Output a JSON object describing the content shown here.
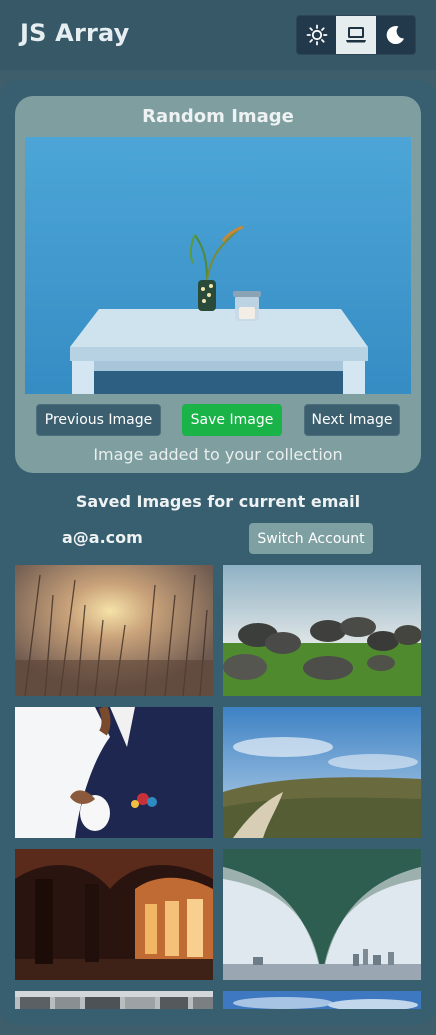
{
  "app": {
    "title": "JS Array"
  },
  "theme_switcher": {
    "options": [
      {
        "name": "light",
        "icon": "sun-icon"
      },
      {
        "name": "system",
        "icon": "laptop-icon",
        "active": true
      },
      {
        "name": "dark",
        "icon": "moon-icon"
      }
    ]
  },
  "random_image": {
    "title": "Random Image",
    "image": "vase-on-table-blue-wall",
    "buttons": {
      "previous": "Previous Image",
      "save": "Save Image",
      "next": "Next Image"
    },
    "status": "Image added to your collection"
  },
  "saved": {
    "title": "Saved Images for current email",
    "email": "a@a.com",
    "switch_label": "Switch Account",
    "images": [
      "sunset-grass",
      "rocks-field",
      "man-coffee-suit",
      "hill-path-sky",
      "arched-corridor",
      "bridge-underside",
      "town-row",
      "sky-clouds"
    ]
  },
  "colors": {
    "background": "#3d5e6a",
    "header": "#375867",
    "card": "#7e9e9f",
    "save_button": "#19b348",
    "dark_button": "#3b5f6f"
  }
}
